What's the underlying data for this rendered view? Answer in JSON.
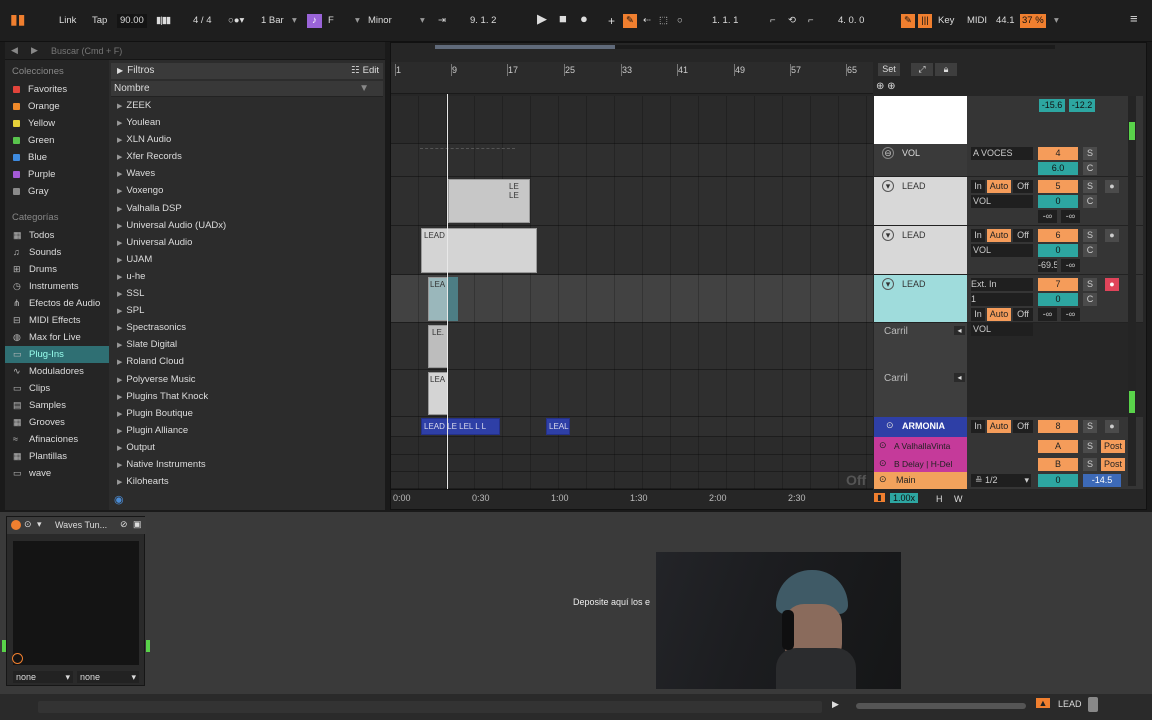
{
  "topbar": {
    "link": "Link",
    "tap": "Tap",
    "tempo": "90.00",
    "signature": "4 / 4",
    "quantize": "1 Bar",
    "key_root": "F",
    "scale": "Minor",
    "position": "9.  1.  2",
    "loop_start": "1.  1.  1",
    "loop_length": "4.  0.  0",
    "key_label": "Key",
    "midi_label": "MIDI",
    "cpu": "44.1",
    "zoom": "37 %"
  },
  "browser": {
    "search_placeholder": "Buscar (Cmd + F)",
    "collections_title": "Colecciones",
    "collections": [
      {
        "label": "Favorites",
        "color": "#e2443b"
      },
      {
        "label": "Orange",
        "color": "#f08a2a"
      },
      {
        "label": "Yellow",
        "color": "#e6d23a"
      },
      {
        "label": "Green",
        "color": "#59c44d"
      },
      {
        "label": "Blue",
        "color": "#3e8be0"
      },
      {
        "label": "Purple",
        "color": "#a45ad6"
      },
      {
        "label": "Gray",
        "color": "#8a8a8a"
      }
    ],
    "categories_title": "Categorías",
    "categories": [
      {
        "label": "Todos",
        "icon": "grid-icon"
      },
      {
        "label": "Sounds",
        "icon": "sounds-icon"
      },
      {
        "label": "Drums",
        "icon": "drums-icon"
      },
      {
        "label": "Instruments",
        "icon": "instrument-icon"
      },
      {
        "label": "Efectos de Audio",
        "icon": "audio-fx-icon"
      },
      {
        "label": "MIDI Effects",
        "icon": "midi-fx-icon"
      },
      {
        "label": "Max for Live",
        "icon": "max-icon"
      },
      {
        "label": "Plug-Ins",
        "icon": "plugin-icon",
        "selected": true
      },
      {
        "label": "Moduladores",
        "icon": "modulator-icon"
      },
      {
        "label": "Clips",
        "icon": "clips-icon"
      },
      {
        "label": "Samples",
        "icon": "samples-icon"
      },
      {
        "label": "Grooves",
        "icon": "grooves-icon"
      },
      {
        "label": "Afinaciones",
        "icon": "tuning-icon"
      },
      {
        "label": "Plantillas",
        "icon": "templates-icon"
      },
      {
        "label": "wave",
        "icon": "folder-icon"
      }
    ],
    "filters_label": "Filtros",
    "edit_label": "Edit",
    "name_header": "Nombre",
    "items": [
      "ZEEK",
      "Youlean",
      "XLN Audio",
      "Xfer Records",
      "Waves",
      "Voxengo",
      "Valhalla DSP",
      "Universal Audio (UADx)",
      "Universal Audio",
      "UJAM",
      "u-he",
      "SSL",
      "SPL",
      "Spectrasonics",
      "Slate Digital",
      "Roland Cloud",
      "Polyverse Music",
      "Plugins That Knock",
      "Plugin Boutique",
      "Plugin Alliance",
      "Output",
      "Native Instruments",
      "Kilohearts"
    ]
  },
  "arrangement": {
    "ruler_bars": [
      "1",
      "9",
      "17",
      "25",
      "33",
      "41",
      "49",
      "57",
      "65"
    ],
    "time_marks": [
      "0:00",
      "0:30",
      "1:00",
      "1:30",
      "2:00",
      "2:30"
    ],
    "set_label": "Set",
    "off_label": "Off",
    "clips": {
      "lead_a": "LE LE",
      "lead_b": "LEAD",
      "lead_c": "LEA",
      "lead_d": "LE.",
      "lead_e": "LEA",
      "armonia": "LEAD LE LEL L L",
      "armonia_b": "LEAL"
    }
  },
  "mixer": {
    "master_meter": [
      "-15.6",
      "-12.2"
    ],
    "tracks": [
      {
        "name": "VOL",
        "route": "A VOCES",
        "num": "4",
        "s": "S",
        "vol": "6.0",
        "pan": "C"
      },
      {
        "name": "LEAD",
        "in": "In",
        "auto": "Auto",
        "off": "Off",
        "num": "5",
        "s": "S",
        "send": "VOL",
        "vol": "0",
        "pan": "C",
        "l": "-∞",
        "r": "-∞"
      },
      {
        "name": "LEAD",
        "in": "In",
        "auto": "Auto",
        "off": "Off",
        "num": "6",
        "s": "S",
        "send": "VOL",
        "vol": "0",
        "pan": "C",
        "l": "-69.5",
        "r": "-∞"
      },
      {
        "name": "LEAD",
        "input": "Ext. In",
        "chan": "1",
        "in": "In",
        "auto": "Auto",
        "off": "Off",
        "num": "7",
        "s": "S",
        "send": "VOL",
        "vol": "0",
        "pan": "C",
        "l": "-∞",
        "r": "-∞"
      }
    ],
    "carril": "Carril",
    "armonia": {
      "name": "ARMONIA",
      "in": "In",
      "auto": "Auto",
      "off": "Off",
      "num": "8",
      "s": "S"
    },
    "returns": [
      {
        "name": "A ValhallaVinta",
        "letter": "A",
        "s": "S",
        "post": "Post"
      },
      {
        "name": "B Delay | H-Del",
        "letter": "B",
        "s": "S",
        "post": "Post"
      }
    ],
    "main": {
      "name": "Main",
      "route": "1/2",
      "vol": "0",
      "meter": "-14.5"
    },
    "speed": "1.00x",
    "h": "H",
    "w": "W"
  },
  "device": {
    "name": "Waves Tun...",
    "sel_a": "none",
    "sel_b": "none",
    "drop_hint": "Deposite aquí los e"
  },
  "status": {
    "track": "LEAD"
  }
}
